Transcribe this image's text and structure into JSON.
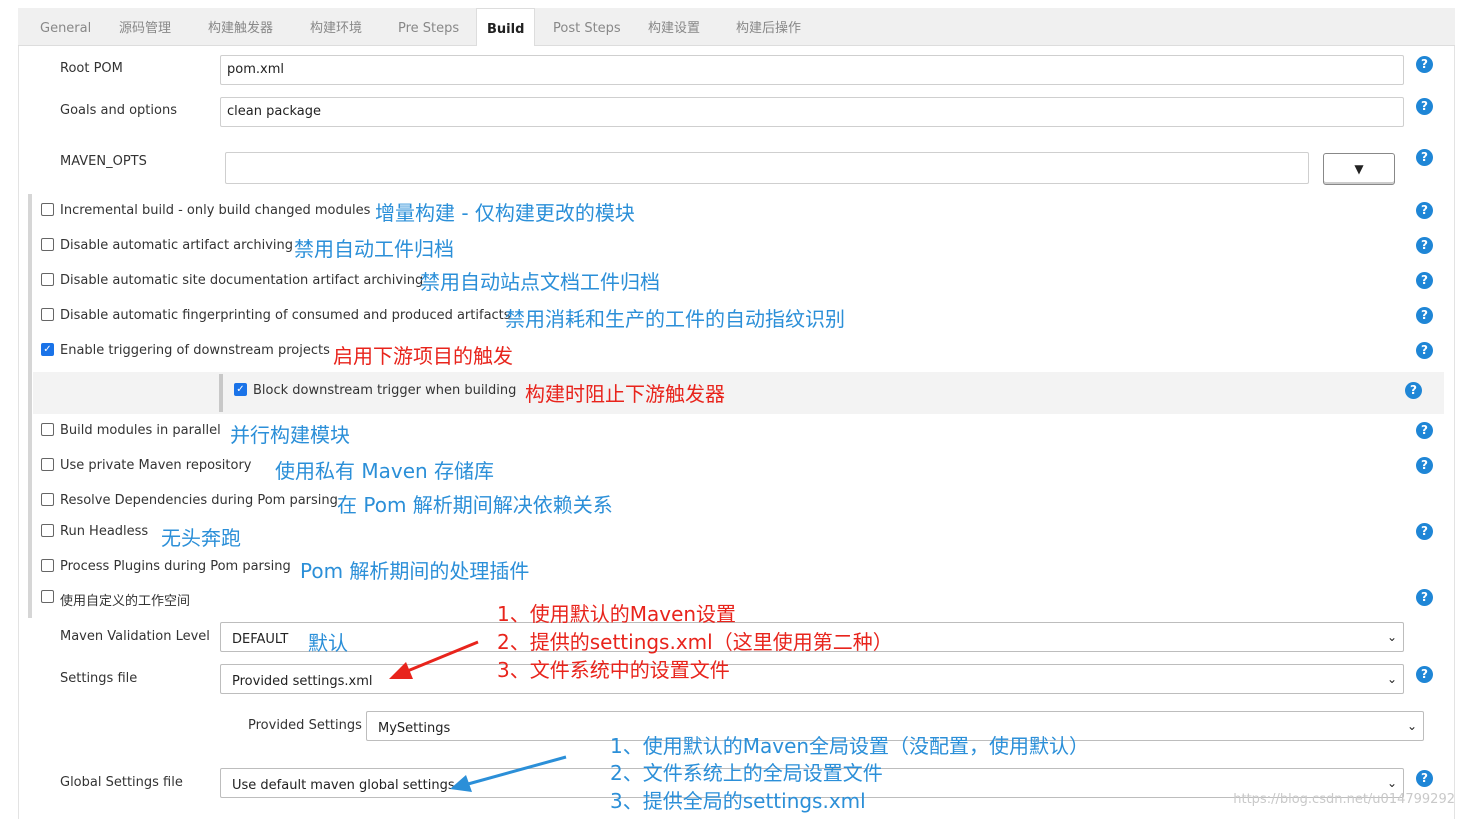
{
  "tabs": [
    "General",
    "源码管理",
    "构建触发器",
    "构建环境",
    "Pre Steps",
    "Build",
    "Post Steps",
    "构建设置",
    "构建后操作"
  ],
  "active_tab": "Build",
  "root_pom": {
    "label": "Root POM",
    "value": "pom.xml"
  },
  "goals": {
    "label": "Goals and options",
    "value": "clean package"
  },
  "maven_opts": {
    "label": "MAVEN_OPTS",
    "value": "",
    "dropdown_glyph": "▼"
  },
  "help_glyph": "?",
  "options": [
    {
      "label": "Incremental build - only build changed modules",
      "checked": false,
      "annotation": "增量构建 - 仅构建更改的模块"
    },
    {
      "label": "Disable automatic artifact archiving",
      "checked": false,
      "annotation": "禁用自动工件归档"
    },
    {
      "label": "Disable automatic site documentation artifact archiving",
      "checked": false,
      "annotation": "禁用自动站点文档工件归档"
    },
    {
      "label": "Disable automatic fingerprinting of consumed and produced artifacts",
      "checked": false,
      "annotation": "禁用消耗和生产的工件的自动指纹识别"
    },
    {
      "label": "Enable triggering of downstream projects",
      "checked": true,
      "annotation": "启用下游项目的触发"
    }
  ],
  "nested_option": {
    "label": "Block downstream trigger when building",
    "checked": true,
    "annotation": "构建时阻止下游触发器"
  },
  "options2": [
    {
      "label": "Build modules in parallel",
      "checked": false,
      "annotation": "并行构建模块"
    },
    {
      "label": "Use private Maven repository",
      "checked": false,
      "annotation": "使用私有 Maven 存储库"
    },
    {
      "label": "Resolve Dependencies during Pom parsing",
      "checked": false,
      "annotation": "在 Pom 解析期间解决依赖关系"
    },
    {
      "label": "Run Headless",
      "checked": false,
      "annotation": "无头奔跑"
    },
    {
      "label": "Process Plugins during Pom parsing",
      "checked": false,
      "annotation": "Pom 解析期间的处理插件"
    },
    {
      "label": "使用自定义的工作空间",
      "checked": false,
      "annotation": ""
    }
  ],
  "validation": {
    "label": "Maven Validation Level",
    "value": "DEFAULT",
    "annotation": "默认"
  },
  "settings_file": {
    "label": "Settings file",
    "value": "Provided settings.xml"
  },
  "provided_settings": {
    "label": "Provided Settings",
    "value": "MySettings"
  },
  "global_settings": {
    "label": "Global Settings file",
    "value": "Use default maven global settings"
  },
  "settings_notes": [
    "1、使用默认的Maven设置",
    "2、提供的settings.xml（这里使用第二种）",
    "3、文件系统中的设置文件"
  ],
  "global_notes": [
    "1、使用默认的Maven全局设置（没配置，使用默认）",
    "2、文件系统上的全局设置文件",
    "3、提供全局的settings.xml"
  ],
  "colors": {
    "annotation_blue": "#2b8fd8",
    "annotation_red": "#e8241c",
    "help": "#1f86d6"
  },
  "watermark": "https://blog.csdn.net/u014799292"
}
